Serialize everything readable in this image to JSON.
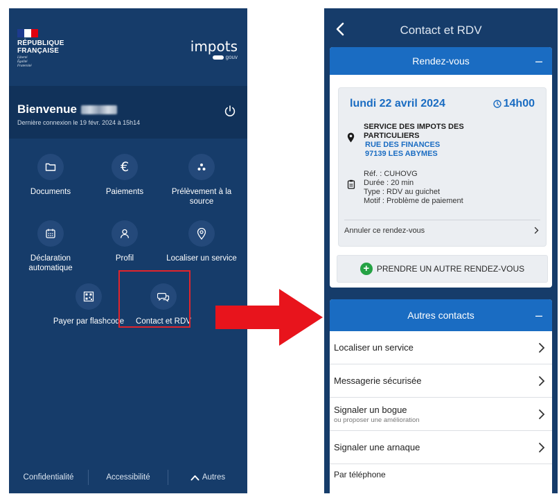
{
  "left_screen": {
    "brand": {
      "rf_line1": "RÉPUBLIQUE",
      "rf_line2": "FRANÇAISE",
      "motto": [
        "Liberté",
        "Égalité",
        "Fraternité"
      ],
      "impots_word": "impots",
      "gouv_word": "gouv",
      "flag_colors": [
        "#1d3b8f",
        "#ffffff",
        "#e1000f"
      ]
    },
    "welcome": {
      "title": "Bienvenue",
      "last_connection": "Dernière connexion le 19 févr. 2024 à 15h14"
    },
    "tiles": [
      {
        "label": "Documents",
        "icon": "folder-icon"
      },
      {
        "label": "Paiements",
        "icon": "euro-icon"
      },
      {
        "label": "Prélèvement à la source",
        "icon": "dots-icon"
      },
      {
        "label": "Déclaration automatique",
        "icon": "calendar-icon"
      },
      {
        "label": "Profil",
        "icon": "user-icon"
      },
      {
        "label": "Localiser un service",
        "icon": "location-icon"
      },
      {
        "label": "Payer par flashcode",
        "icon": "qr-code-icon"
      },
      {
        "label": "Contact et RDV",
        "icon": "chat-bubbles-icon"
      }
    ],
    "footer": {
      "privacy": "Confidentialité",
      "accessibility": "Accessibilité",
      "more": "Autres"
    }
  },
  "right_screen": {
    "title": "Contact et RDV",
    "appointments_section": {
      "title": "Rendez-vous",
      "toggle": "–",
      "appointment": {
        "date": "lundi 22 avril 2024",
        "time": "14h00",
        "service_line1": "SERVICE DES IMPOTS DES",
        "service_line2": "PARTICULIERS",
        "address_line1": "RUE DES FINANCES",
        "address_line2": "97139 LES ABYMES",
        "reference": "Réf. : CUHOVG",
        "duration": "Durée : 20 min",
        "type": "Type : RDV au guichet",
        "reason": "Motif : Problème de paiement",
        "cancel": "Annuler ce rendez-vous"
      },
      "new_appointment": "PRENDRE UN AUTRE RENDEZ-VOUS"
    },
    "contacts_section": {
      "title": "Autres contacts",
      "toggle": "–",
      "items": [
        {
          "label": "Localiser un service"
        },
        {
          "label": "Messagerie sécurisée"
        },
        {
          "label": "Signaler un bogue",
          "sub": "ou proposer une amélioration"
        },
        {
          "label": "Signaler une arnaque"
        }
      ],
      "phone": "Par téléphone"
    }
  },
  "colors": {
    "navy": "#163c6a",
    "accent_blue": "#1a6cc2",
    "highlight_red": "#e3242b",
    "green": "#25a244"
  }
}
